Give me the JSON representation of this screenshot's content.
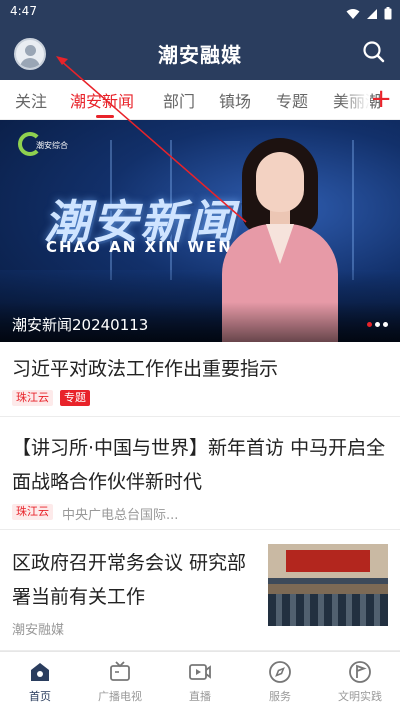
{
  "status_bar": {
    "time": "4:47"
  },
  "header": {
    "title": "潮安融媒"
  },
  "tabs": [
    {
      "label": "关注",
      "active": false
    },
    {
      "label": "潮安新闻",
      "active": true
    },
    {
      "label": "部门",
      "active": false
    },
    {
      "label": "镇场",
      "active": false
    },
    {
      "label": "专题",
      "active": false
    },
    {
      "label": "美丽潮",
      "active": false
    }
  ],
  "tab_add_icon": "plus-icon",
  "banner": {
    "logo_text": "潮安综合",
    "show_title": "潮安新闻",
    "show_pinyin": "CHAO AN XIN WEN",
    "caption": "潮安新闻20240113",
    "slide_count": 3,
    "active_slide": 1
  },
  "feed": [
    {
      "title": "习近平对政法工作作出重要指示",
      "source_tag": "珠江云",
      "topic_tag": "专题"
    },
    {
      "title_line1": "【讲习所·中国与世界】新年首访 中马开启全",
      "title_line2": "面战略合作伙伴新时代",
      "source_tag": "珠江云",
      "publisher": "中央广电总台国际..."
    },
    {
      "title_line1": "区政府召开常务会议 研究部",
      "title_line2": "署当前有关工作",
      "publisher": "潮安融媒",
      "thumbnail": "meeting-photo"
    }
  ],
  "bottom_nav": [
    {
      "label": "首页",
      "icon": "home-icon",
      "active": true
    },
    {
      "label": "广播电视",
      "icon": "tv-icon",
      "active": false
    },
    {
      "label": "直播",
      "icon": "live-video-icon",
      "active": false
    },
    {
      "label": "服务",
      "icon": "compass-icon",
      "active": false
    },
    {
      "label": "文明实践",
      "icon": "flag-badge-icon",
      "active": false
    }
  ],
  "colors": {
    "header_bg": "#2a3d5e",
    "accent_red": "#e8232a"
  }
}
